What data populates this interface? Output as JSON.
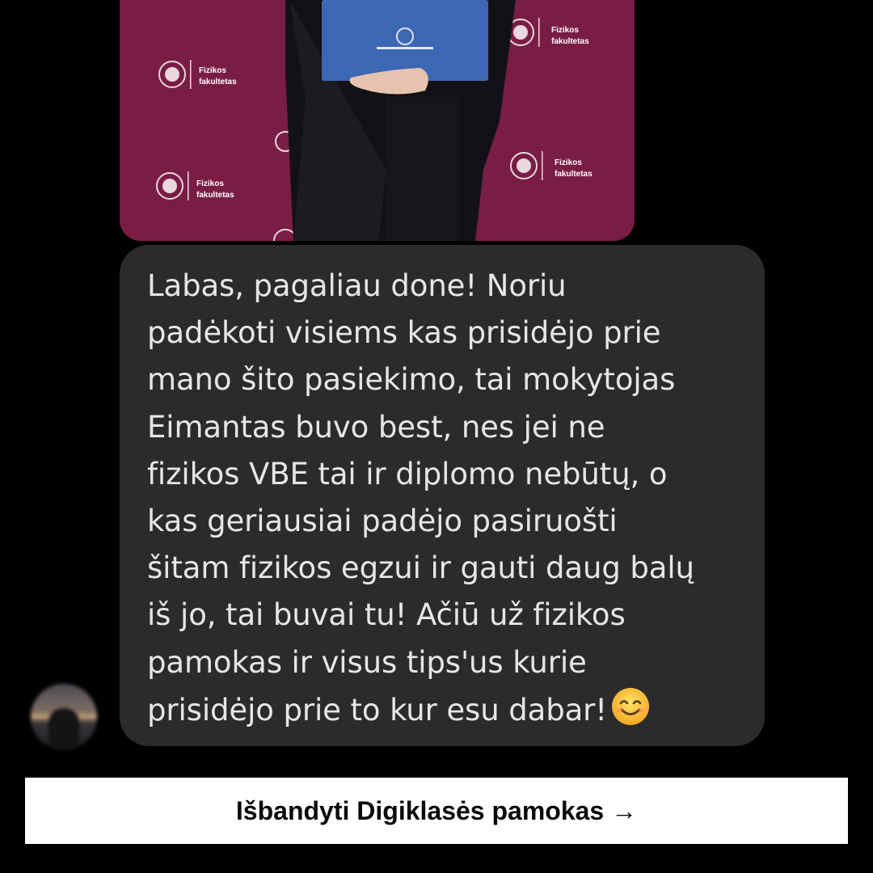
{
  "photo": {
    "backdrop_color": "#7a1d45",
    "logo_line1": "Fizikos",
    "logo_line2": "fakultetas"
  },
  "message": {
    "lines": [
      "Labas, pagaliau done! Noriu",
      "padėkoti visiems kas prisidėjo prie",
      "mano šito pasiekimo, tai mokytojas",
      "Eimantas buvo best, nes jei ne",
      "fizikos VBE tai ir diplomo nebūtų, o",
      "kas geriausiai padėjo pasiruošti",
      "šitam fizikos egzui ir gauti daug balų",
      "iš jo, tai buvai tu! Ačiū už fizikos",
      "pamokas ir visus tips'us kurie",
      "prisidėjo prie to kur esu dabar!"
    ],
    "emoji": "smiling-face-icon"
  },
  "cta": {
    "label": "Išbandyti Digiklasės pamokas →"
  },
  "colors": {
    "background": "#000000",
    "bubble": "#2b2b2d",
    "bubble_text": "#e6e6e8",
    "cta_background": "#ffffff",
    "cta_text": "#0a0a0a"
  }
}
